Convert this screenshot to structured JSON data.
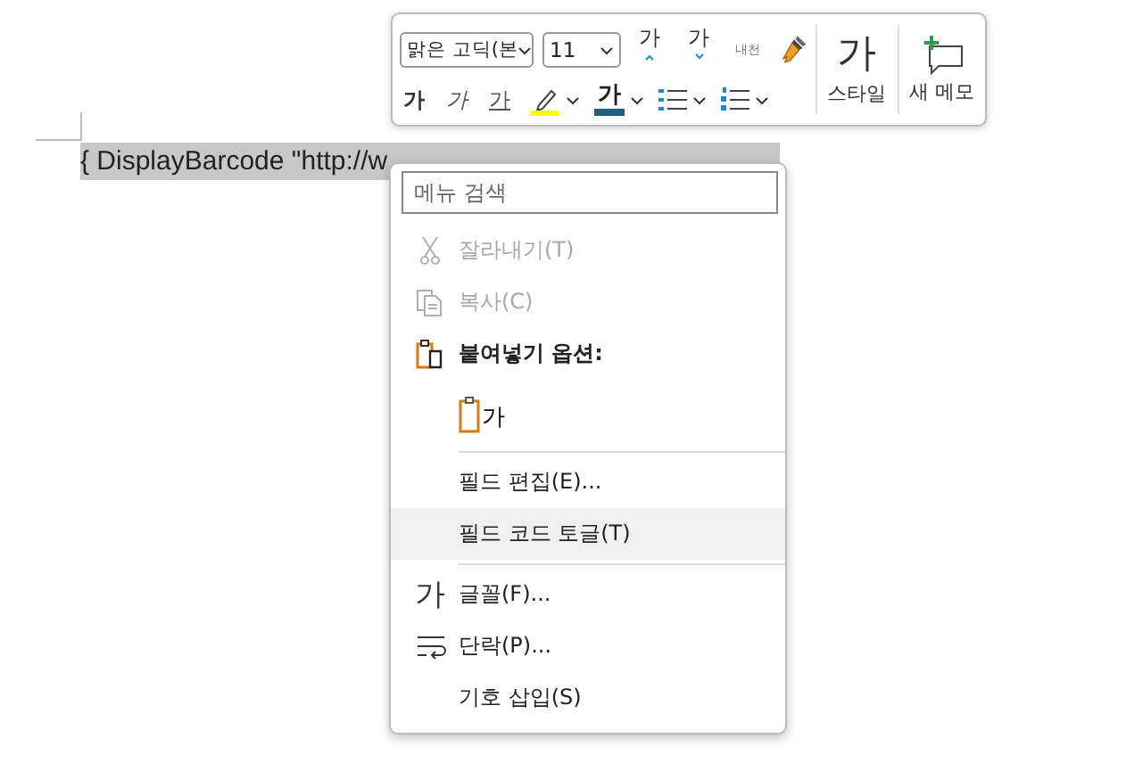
{
  "document": {
    "field_text": "{ DisplayBarcode \"http://w"
  },
  "mini_toolbar": {
    "font_name": "맑은 고딕(본",
    "font_size": "11",
    "grow_glyph": "가",
    "shrink_glyph": "가",
    "hanja_text": "내천",
    "styles_glyph": "가",
    "styles_label": "스타일",
    "new_comment_label": "새 메모",
    "bold_glyph": "가",
    "italic_glyph": "가",
    "underline_glyph": "가",
    "font_color_glyph": "가"
  },
  "context_menu": {
    "search_placeholder": "메뉴 검색",
    "items": [
      {
        "kind": "item",
        "label": "잘라내기(T)",
        "disabled": true,
        "selected": false
      },
      {
        "kind": "item",
        "label": "복사(C)",
        "disabled": true,
        "selected": false
      },
      {
        "kind": "heading",
        "label": "붙여넣기 옵션:"
      },
      {
        "kind": "paste-option",
        "glyph": "가"
      },
      {
        "kind": "separator"
      },
      {
        "kind": "item",
        "label": "필드 편집(E)...",
        "disabled": false,
        "selected": false
      },
      {
        "kind": "item",
        "label": "필드 코드 토글(T)",
        "disabled": false,
        "selected": true
      },
      {
        "kind": "separator"
      },
      {
        "kind": "item",
        "glyph": "가",
        "label": "글꼴(F)...",
        "disabled": false,
        "selected": false
      },
      {
        "kind": "item",
        "label": "단락(P)...",
        "disabled": false,
        "selected": false
      },
      {
        "kind": "item",
        "label": "기호 삽입(S)",
        "disabled": false,
        "selected": false
      }
    ]
  }
}
